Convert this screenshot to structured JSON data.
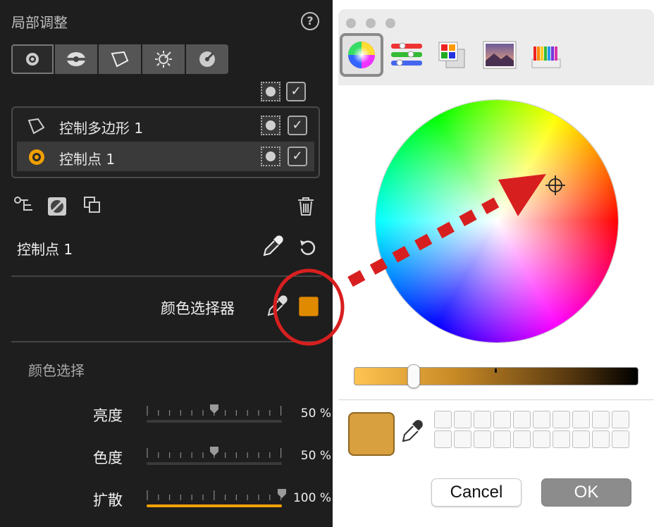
{
  "left_panel": {
    "title": "局部调整",
    "help_label": "?",
    "tools": [
      "control-point-icon",
      "radial-icon",
      "polygon-icon",
      "point-sun-icon",
      "gradient-icon"
    ],
    "master_checkbox": "✓",
    "list": [
      {
        "label": "控制多边形 1",
        "icon": "polygon-icon",
        "checked": "✓"
      },
      {
        "label": "控制点 1",
        "icon": "control-point-icon",
        "checked": "✓"
      }
    ],
    "selected_name": "控制点 1",
    "color_selector_label": "颜色选择器",
    "swatch_color": "#e08a00",
    "section_label": "颜色选择",
    "sliders": [
      {
        "name": "亮度",
        "value": "50 %",
        "level": 0.5
      },
      {
        "name": "色度",
        "value": "50 %",
        "level": 0.5
      },
      {
        "name": "扩散",
        "value": "100 %",
        "level": 1.0
      }
    ],
    "accent_color": "#f0a000"
  },
  "color_panel": {
    "modes": [
      "color-wheel-icon",
      "color-sliders-icon",
      "color-palettes-icon",
      "image-palettes-icon",
      "pencils-icon"
    ],
    "active_mode": "color-wheel-icon",
    "current_color": "#d9a03f",
    "brightness_level": 0.2,
    "cancel_label": "Cancel",
    "ok_label": "OK"
  },
  "annotation_color": "#d81f1f"
}
